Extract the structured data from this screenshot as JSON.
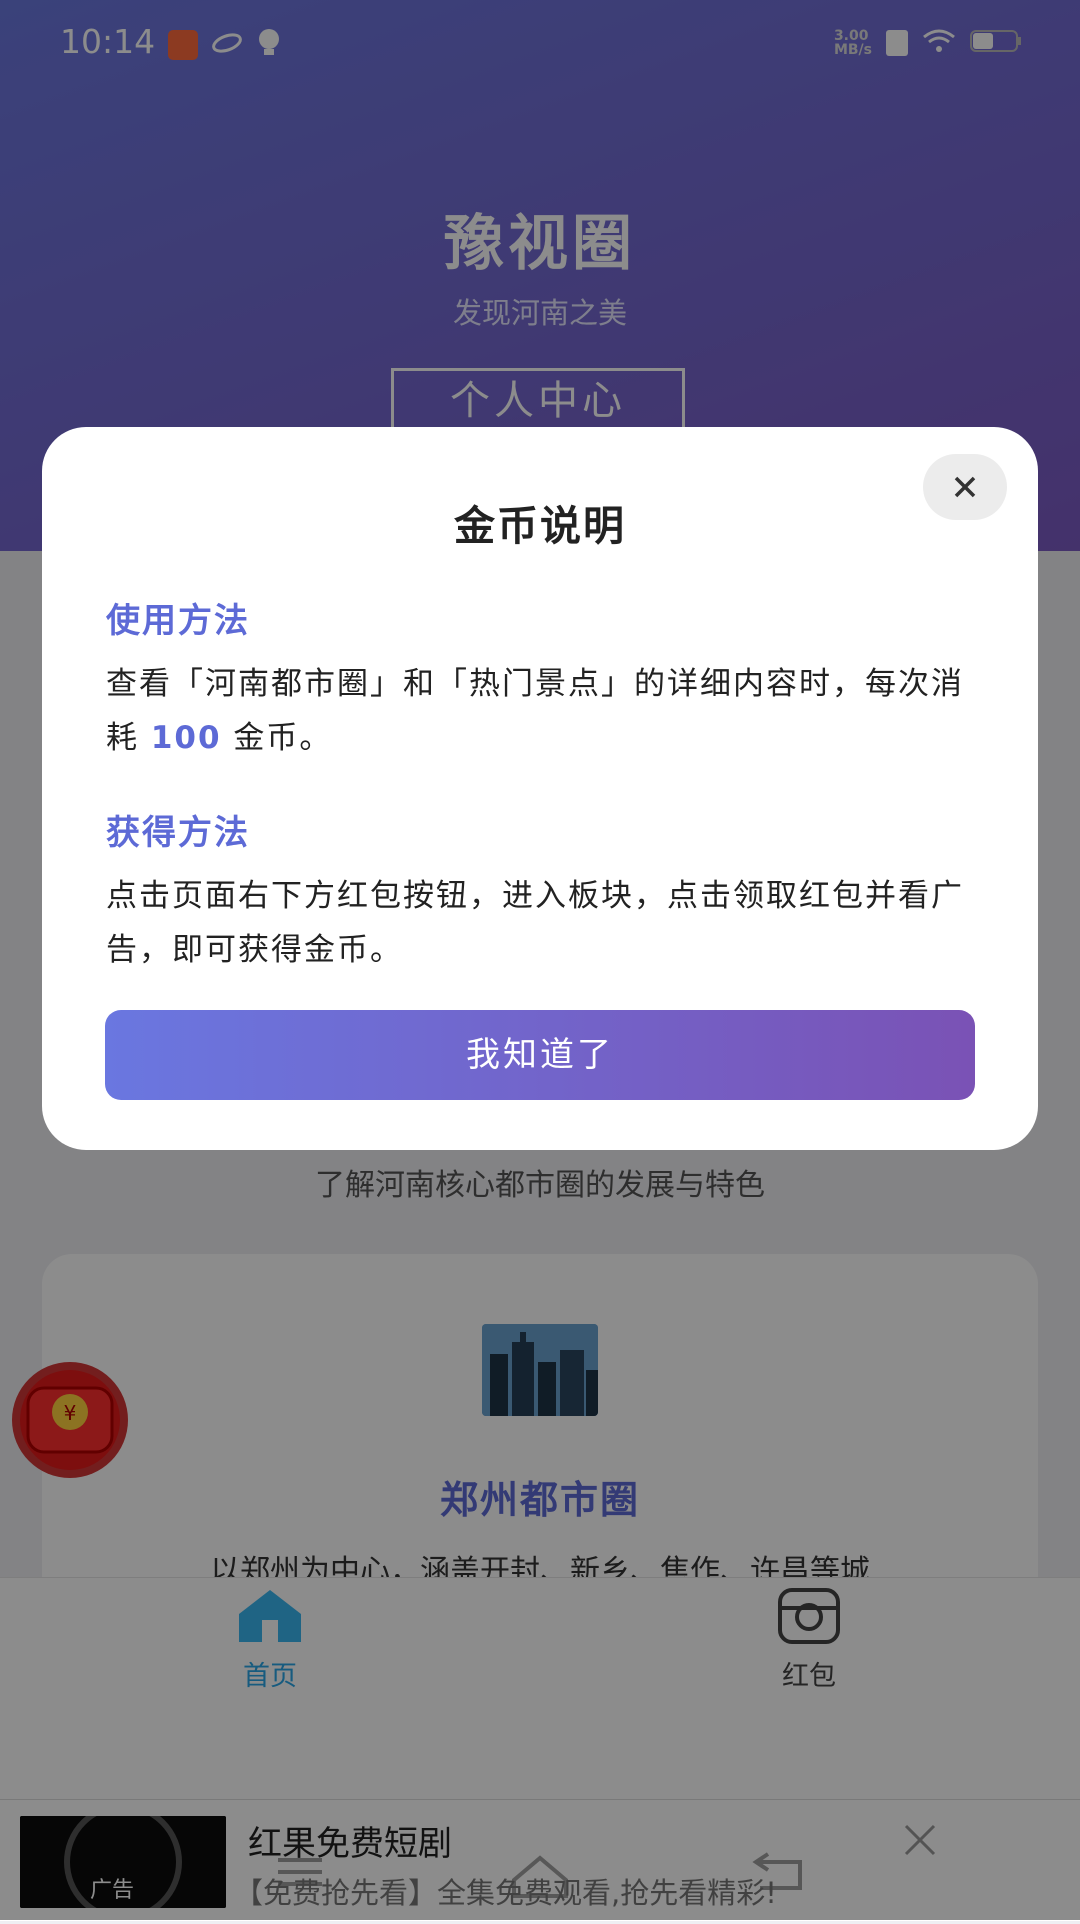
{
  "status_bar": {
    "time": "10:14",
    "net_speed": "3.00\nMB/s"
  },
  "header": {
    "title": "豫视圈",
    "subtitle": "发现河南之美",
    "profile_button": "个人中心"
  },
  "section": {
    "caption": "了解河南核心都市圈的发展与特色"
  },
  "card": {
    "title": "郑州都市圈",
    "desc": "以郑州为中心，涵盖开封、新乡、焦作、许昌等城"
  },
  "red_packet": {
    "symbol": "¥"
  },
  "tabbar": {
    "home": "首页",
    "redpacket": "红包"
  },
  "ad": {
    "tag": "广告",
    "title": "红果免费短剧",
    "desc": "【免费抢先看】全集免费观看,抢先看精彩!"
  },
  "modal": {
    "title": "金币说明",
    "usage_heading": "使用方法",
    "usage_text_before": "查看「河南都市圈」和「热门景点」的详细内容时，每次消耗 ",
    "usage_cost": "100",
    "usage_text_after": " 金币。",
    "earn_heading": "获得方法",
    "earn_text": "点击页面右下方红包按钮，进入板块，点击领取红包并看广告，即可获得金币。",
    "ok_button": "我知道了"
  },
  "colors": {
    "accent": "#5d6ad6",
    "header_start": "#6b78df",
    "header_end": "#7d5bc4",
    "home_tab": "#2aa7e8"
  }
}
